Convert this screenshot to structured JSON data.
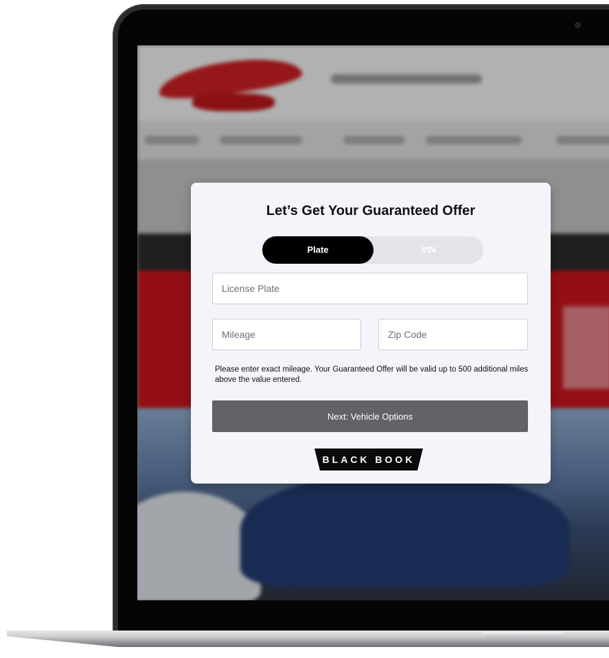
{
  "modal": {
    "title": "Let’s Get Your Guaranteed Offer",
    "toggle": {
      "options": [
        "Plate",
        "VIN"
      ],
      "selected": "Plate"
    },
    "license_plate": {
      "placeholder": "License Plate",
      "value": ""
    },
    "mileage": {
      "placeholder": "Mileage",
      "value": ""
    },
    "zip": {
      "placeholder": "Zip Code",
      "value": ""
    },
    "note": "Please enter exact mileage. Your Guaranteed Offer will be valid up to 500 additional miles above the value entered.",
    "next_button": "Next: Vehicle Options",
    "brand_logo": "BLACK BOOK"
  },
  "colors": {
    "modal_bg": "#f3f5fb",
    "toggle_active": "#000000",
    "button_bg": "#626366",
    "site_red": "#c5151d"
  },
  "icons": [
    "camera-icon",
    "black-book-logo-icon"
  ]
}
